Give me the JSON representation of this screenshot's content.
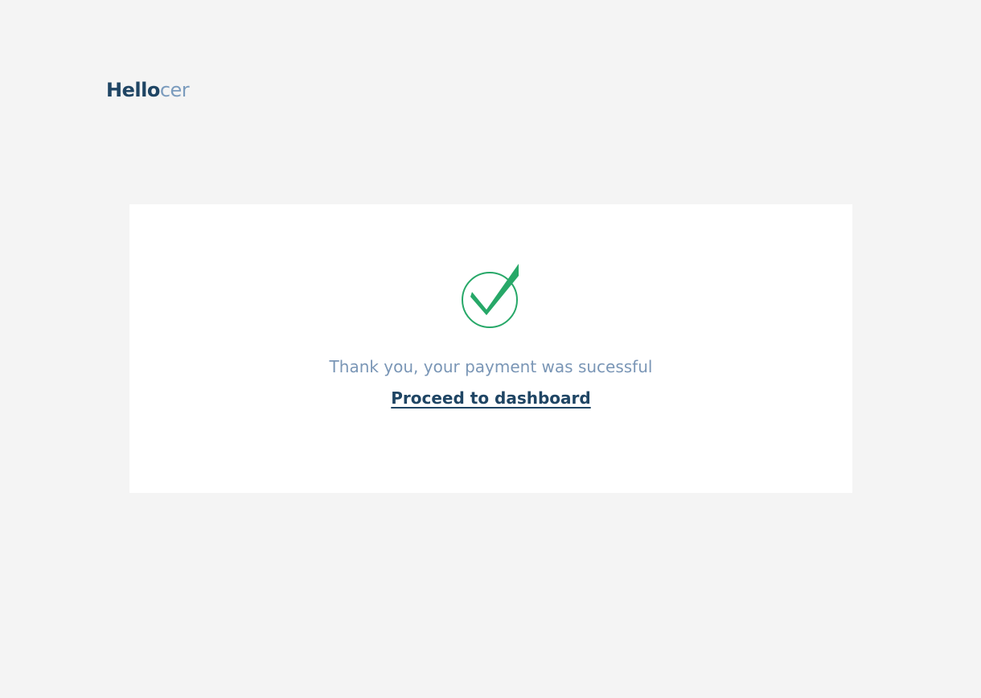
{
  "brand": {
    "name_strong": "Hello",
    "name_light": "cer",
    "colors": {
      "primary": "#1f4564",
      "secondary": "#7a9bbd"
    }
  },
  "payment_status": {
    "icon": "check-circle-icon",
    "icon_color": "#27a868",
    "message": "Thank you, your payment was sucessful",
    "link_label": "Proceed to dashboard"
  }
}
